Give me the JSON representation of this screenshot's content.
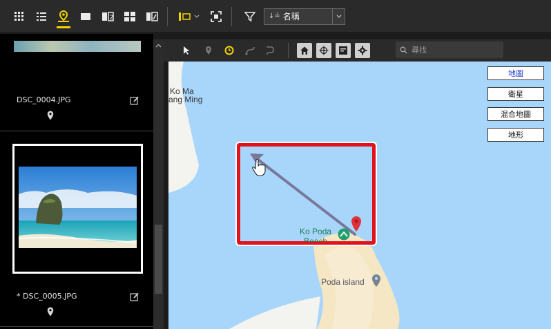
{
  "toolbar": {
    "icons": [
      "grid-view-icon",
      "list-view-icon",
      "map-view-icon",
      "single-view-icon",
      "compare-view-icon",
      "multi-view-icon",
      "edit-view-icon",
      "layout-icon",
      "fullscreen-icon",
      "filter-icon",
      "sort-icon"
    ],
    "sort_label": "名稱"
  },
  "files": [
    {
      "name": "DSC_0004.JPG"
    },
    {
      "name": "* DSC_0005.JPG"
    }
  ],
  "map_toolbar": {
    "search_placeholder": "尋找"
  },
  "map": {
    "labels": {
      "ko_ma": "Ko Ma",
      "ang_ming": "ang Ming",
      "ko_poda": "Ko Poda",
      "beach": "Beach",
      "poda_island": "Poda island"
    },
    "map_types": [
      "地圖",
      "衛星",
      "混合地圖",
      "地形"
    ],
    "selected_type": "地圖"
  },
  "colors": {
    "accent": "#f2d400",
    "map_water": "#a8d6fb",
    "land": "#f5e6c4",
    "highlight": "#e0131a"
  }
}
